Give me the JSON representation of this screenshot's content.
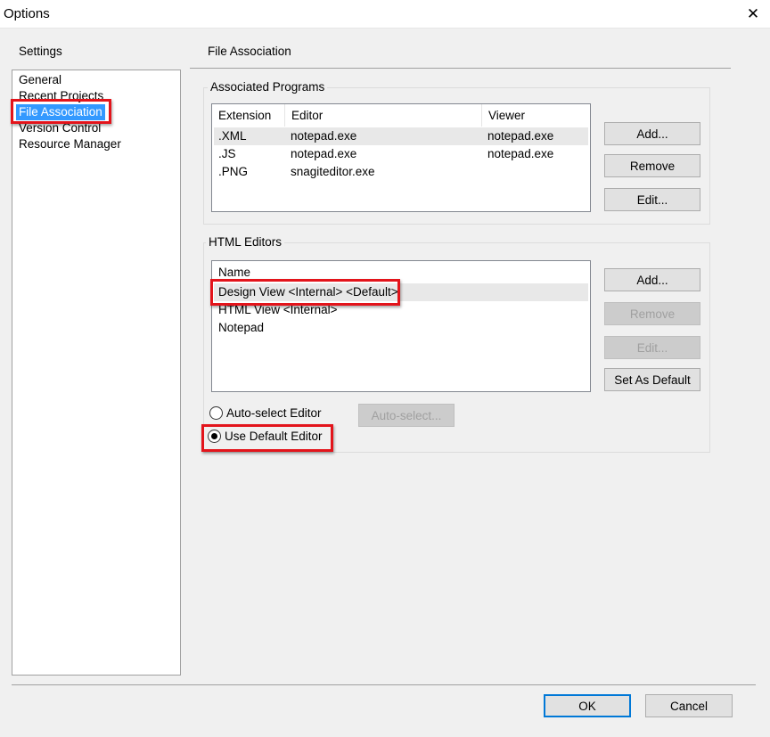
{
  "window": {
    "title": "Options",
    "close_glyph": "✕"
  },
  "settings": {
    "label": "Settings",
    "items": [
      {
        "label": "General"
      },
      {
        "label": "Recent Projects"
      },
      {
        "label": "File Association",
        "selected": true
      },
      {
        "label": "Version Control"
      },
      {
        "label": "Resource Manager"
      }
    ]
  },
  "panel": {
    "title": "File Association"
  },
  "associated_programs": {
    "label": "Associated Programs",
    "columns": [
      "Extension",
      "Editor",
      "Viewer"
    ],
    "rows": [
      {
        "extension": ".XML",
        "editor": "notepad.exe",
        "viewer": "notepad.exe"
      },
      {
        "extension": ".JS",
        "editor": "notepad.exe",
        "viewer": "notepad.exe"
      },
      {
        "extension": ".PNG",
        "editor": "snagiteditor.exe",
        "viewer": ""
      }
    ],
    "buttons": {
      "add": "Add...",
      "remove": "Remove",
      "edit": "Edit..."
    }
  },
  "html_editors": {
    "label": "HTML Editors",
    "column": "Name",
    "rows": [
      {
        "name": "Design View <Internal> <Default>"
      },
      {
        "name": "HTML View <Internal>"
      },
      {
        "name": "Notepad"
      }
    ],
    "buttons": {
      "add": "Add...",
      "remove": "Remove",
      "edit": "Edit...",
      "set_default": "Set As Default"
    },
    "options": {
      "auto_select": "Auto-select Editor",
      "use_default": "Use Default Editor",
      "selected": "use_default",
      "auto_select_button": "Auto-select..."
    }
  },
  "footer": {
    "ok": "OK",
    "cancel": "Cancel"
  },
  "colors": {
    "highlight_box": "#e3141b",
    "selection": "#3399ff",
    "default_button_border": "#0078d7"
  }
}
